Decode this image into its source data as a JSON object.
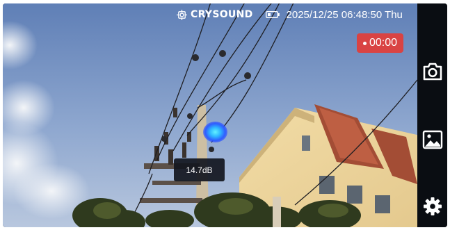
{
  "status_bar": {
    "brand": "CRYSOUND",
    "datetime": "2025/12/25 06:48:50 Thu",
    "brand_icon": "brand-logo-icon",
    "battery_icon": "battery-icon"
  },
  "recording": {
    "timer": "00:00",
    "color": "#d94343"
  },
  "measurement": {
    "level": "14.7dB"
  },
  "hotspot_colors": [
    "#63f1ff",
    "#2fb8ff",
    "#2f5cff"
  ],
  "side_toolbar": {
    "buttons": [
      {
        "icon": "camera-icon"
      },
      {
        "icon": "gallery-icon"
      },
      {
        "icon": "settings-icon"
      }
    ]
  }
}
